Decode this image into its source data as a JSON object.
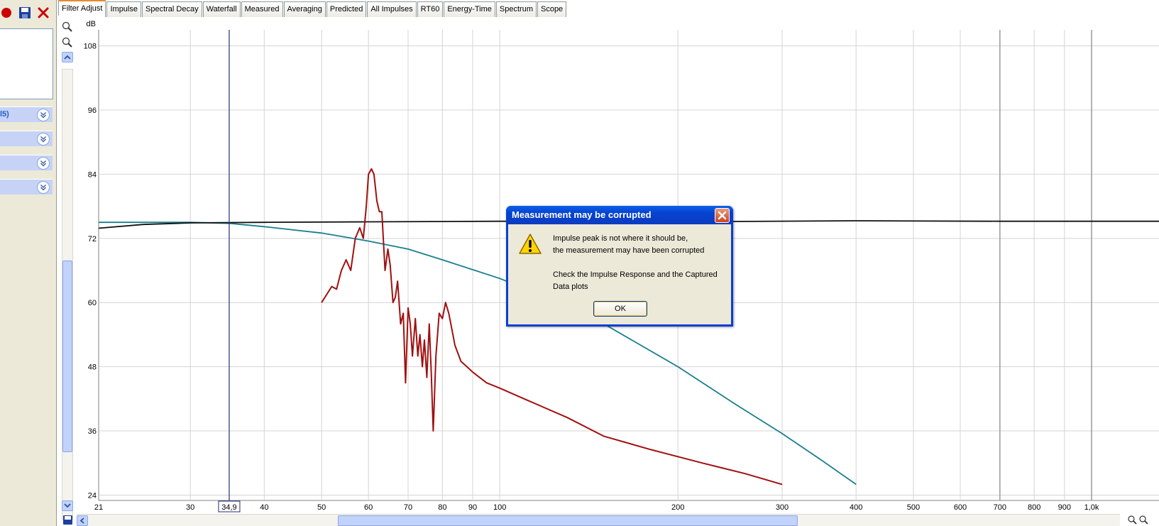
{
  "tabs": [
    {
      "label": "Filter Adjust",
      "active": true
    },
    {
      "label": "Impulse",
      "active": false
    },
    {
      "label": "Spectral Decay",
      "active": false
    },
    {
      "label": "Waterfall",
      "active": false
    },
    {
      "label": "Measured",
      "active": false
    },
    {
      "label": "Averaging",
      "active": false
    },
    {
      "label": "Predicted",
      "active": false
    },
    {
      "label": "All Impulses",
      "active": false
    },
    {
      "label": "RT60",
      "active": false
    },
    {
      "label": "Energy-Time",
      "active": false
    },
    {
      "label": "Spectrum",
      "active": false
    },
    {
      "label": "Scope",
      "active": false
    }
  ],
  "left_panel": {
    "icons": [
      "record-icon",
      "save-icon",
      "close-icon"
    ],
    "colors": {
      "record": "#cc0000",
      "close": "#cc0000",
      "save": "#1f3f9f"
    },
    "rows": [
      {
        "label": "l5)"
      },
      {
        "label": ""
      },
      {
        "label": ""
      },
      {
        "label": ""
      }
    ]
  },
  "cursor_readout": "34,9",
  "dialog": {
    "title": "Measurement may be corrupted",
    "lines": [
      "Impulse peak is not where it should be,",
      "the measurement may have been corrupted",
      "",
      "Check the Impulse Response and the Captured",
      "Data plots"
    ],
    "ok_label": "OK"
  },
  "chart_data": {
    "type": "line",
    "ylabel": "dB",
    "xscale": "log",
    "xlim": [
      21,
      1300
    ],
    "ylim": [
      23,
      111
    ],
    "grid": true,
    "y_ticks": [
      108,
      96,
      84,
      72,
      60,
      48,
      36,
      24
    ],
    "x_ticks": [
      {
        "value": 21,
        "label": "21"
      },
      {
        "value": 30,
        "label": "30"
      },
      {
        "value": 40,
        "label": "40"
      },
      {
        "value": 50,
        "label": "50"
      },
      {
        "value": 60,
        "label": "60"
      },
      {
        "value": 70,
        "label": "70"
      },
      {
        "value": 80,
        "label": "80"
      },
      {
        "value": 90,
        "label": "90"
      },
      {
        "value": 100,
        "label": "100"
      },
      {
        "value": 200,
        "label": "200"
      },
      {
        "value": 300,
        "label": "300"
      },
      {
        "value": 400,
        "label": "400"
      },
      {
        "value": 500,
        "label": "500"
      },
      {
        "value": 600,
        "label": "600"
      },
      {
        "value": 700,
        "label": "700"
      },
      {
        "value": 800,
        "label": "800"
      },
      {
        "value": 900,
        "label": "900"
      },
      {
        "value": 1000,
        "label": "1,0k"
      }
    ],
    "cursor_x": 34.9,
    "series": [
      {
        "color": "#1a7f8f",
        "x": [
          21,
          25,
          30,
          35,
          40,
          50,
          60,
          70,
          80,
          100,
          120,
          150,
          200,
          250,
          300,
          350,
          400
        ],
        "y": [
          75,
          75,
          75,
          74.8,
          74.2,
          73,
          71.5,
          70,
          68,
          64.5,
          61,
          56,
          48,
          41,
          35.5,
          30.5,
          26
        ]
      },
      {
        "color": "#111111",
        "x": [
          21,
          25,
          30,
          40,
          60,
          100,
          200,
          400,
          700,
          1300
        ],
        "y": [
          73.9,
          74.6,
          74.9,
          75,
          75.1,
          75.2,
          75.1,
          75.3,
          75.2,
          75.2
        ]
      },
      {
        "color": "#a01010",
        "x": [
          50,
          51,
          52,
          53,
          54,
          55,
          56,
          57,
          58,
          58.8,
          59.5,
          60,
          60.7,
          61.3,
          62,
          62.6,
          63.2,
          64,
          64.7,
          65.3,
          66,
          66.6,
          67.2,
          68,
          68.7,
          69.3,
          70,
          70.6,
          71.2,
          72,
          72.7,
          73.3,
          74,
          74.6,
          75.3,
          76,
          76.6,
          77.2,
          78,
          79,
          80,
          81,
          82,
          83,
          84,
          86,
          88,
          90,
          95,
          100,
          110,
          130,
          150,
          180,
          220,
          260,
          300
        ],
        "y": [
          60,
          61.5,
          63,
          62.5,
          66,
          68,
          66,
          72,
          74,
          72,
          78,
          84,
          85,
          84,
          79,
          77,
          77,
          66,
          70,
          67,
          60,
          61,
          64,
          56,
          58,
          45,
          59,
          56,
          50,
          57,
          50,
          54,
          48,
          53,
          46,
          56,
          47,
          36,
          50,
          58,
          57,
          60,
          58,
          55,
          52,
          49,
          48,
          47,
          45,
          44,
          42,
          38.5,
          35,
          32.5,
          30,
          28,
          26
        ]
      }
    ]
  }
}
